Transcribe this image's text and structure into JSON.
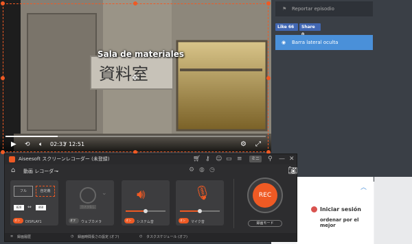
{
  "player": {
    "subtitle": "Sala de materiales",
    "sign_text": "資料室",
    "current_time": "02:33",
    "separator": "/",
    "total_time": "12:51",
    "progress": 0.2
  },
  "page": {
    "report_label": "Reportar episodio",
    "fb_like": "Like 66",
    "fb_share": "Share 0",
    "sidebar_label": "Barra lateral oculta",
    "login_label": "Iniciar sesión",
    "sort_label": "ordenar por el mejor"
  },
  "recorder": {
    "title": "Aiseesoft スクリーンレコーダー (未登録)",
    "badge": "ミニ",
    "mode": "動画 レコーダー",
    "screen": {
      "btn_full": "フル",
      "btn_custom": "自定義",
      "width": "820",
      "height": "460",
      "toggle": "オン",
      "display": "DISPLAY1"
    },
    "webcam": {
      "toggle": "オフ",
      "label": "ウェブカメラ",
      "overlay": "カメラなし"
    },
    "system_audio": {
      "toggle": "オン",
      "label": "システム音",
      "level": 0.5
    },
    "microphone": {
      "toggle": "オン",
      "label": "マイク音",
      "level": 0.5
    },
    "rec_label": "REC",
    "rec_mode": "録画モード",
    "bottom": {
      "history": "録画履歴",
      "duration": "録画時間長さの設定 (オフ)",
      "schedule": "タスクスケジュール (オフ)"
    }
  },
  "colors": {
    "accent": "#ef5a24",
    "facebook": "#4267b2",
    "sidebar_blue": "#4a90d9"
  }
}
